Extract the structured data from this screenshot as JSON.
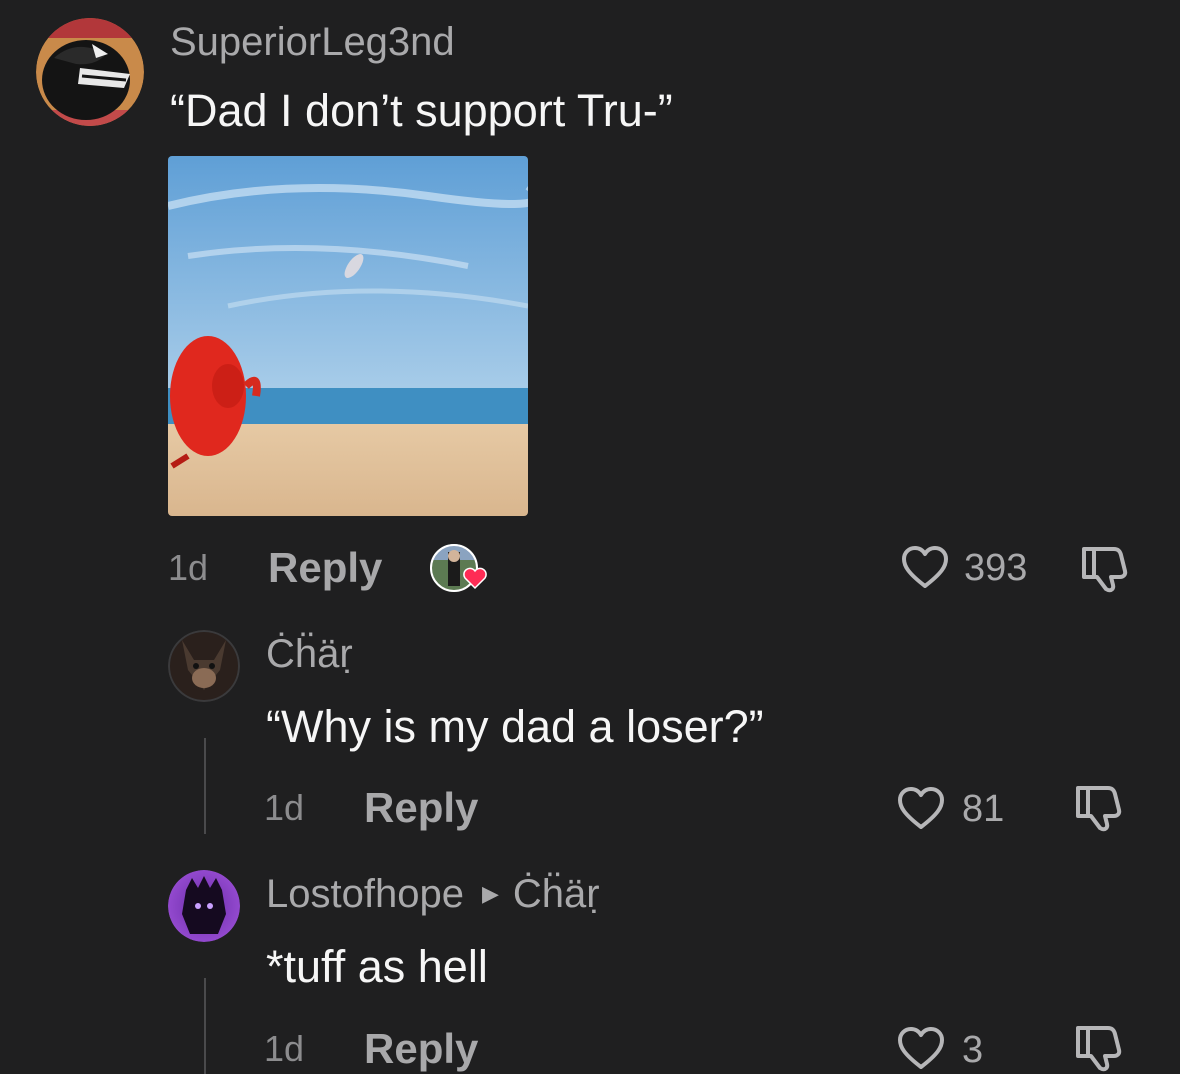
{
  "comments": [
    {
      "username": "SuperiorLeg3nd",
      "text": "“Dad I don’t support Tru-”",
      "time": "1d",
      "reply_label": "Reply",
      "likes": "393"
    },
    {
      "username": "Ċḧäṛ",
      "text": "“Why is my dad a loser?”",
      "time": "1d",
      "reply_label": "Reply",
      "likes": "81"
    },
    {
      "username": "Lostofhope",
      "reply_to": "Ċḧäṛ",
      "text": "*tuff as hell",
      "time": "1d",
      "reply_label": "Reply",
      "likes": "3"
    }
  ],
  "icons": {
    "like": "heart-outline-icon",
    "dislike": "thumbs-down-icon",
    "creator_liked": "creator-liked-heart-icon",
    "reply_arrow": "triangle-right-icon"
  },
  "colors": {
    "background": "#1f1f20",
    "creator_heart": "#fe2c55"
  }
}
